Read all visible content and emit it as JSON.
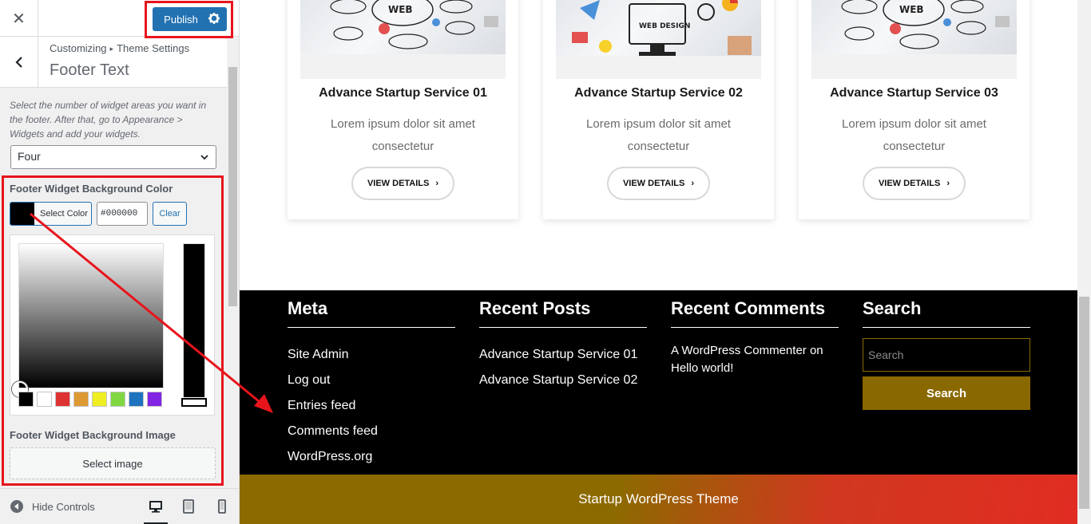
{
  "customizer": {
    "publish_label": "Publish",
    "breadcrumb": {
      "root": "Customizing",
      "parent": "Theme Settings"
    },
    "section_title": "Footer Text",
    "widget_areas": {
      "description": "Select the number of widget areas you want in the footer. After that, go to Appearance > Widgets and add your widgets.",
      "selected": "Four"
    },
    "bg_color": {
      "label": "Footer Widget Background Color",
      "select_label": "Select Color",
      "value": "#000000",
      "clear_label": "Clear",
      "palette": [
        "#000000",
        "#ffffff",
        "#dd3333",
        "#dd9933",
        "#eeee22",
        "#81d742",
        "#1e73be",
        "#8224e3"
      ]
    },
    "bg_image": {
      "label": "Footer Widget Background Image",
      "button_label": "Select image"
    },
    "hide_controls_label": "Hide Controls"
  },
  "preview": {
    "cards": [
      {
        "title": "Advance Startup Service 01",
        "desc": "Lorem ipsum dolor sit amet consectetur",
        "button": "VIEW DETAILS"
      },
      {
        "title": "Advance Startup Service 02",
        "desc": "Lorem ipsum dolor sit amet consectetur",
        "button": "VIEW DETAILS"
      },
      {
        "title": "Advance Startup Service 03",
        "desc": "Lorem ipsum dolor sit amet consectetur",
        "button": "VIEW DETAILS"
      }
    ],
    "footer": {
      "meta": {
        "title": "Meta",
        "links": [
          "Site Admin",
          "Log out",
          "Entries feed",
          "Comments feed",
          "WordPress.org"
        ]
      },
      "recent_posts": {
        "title": "Recent Posts",
        "links": [
          "Advance Startup Service 01",
          "Advance Startup Service 02"
        ]
      },
      "recent_comments": {
        "title": "Recent Comments",
        "text": "A WordPress Commenter on Hello world!"
      },
      "search": {
        "title": "Search",
        "placeholder": "Search",
        "button": "Search"
      }
    },
    "copyright": "Startup WordPress Theme"
  },
  "colors": {
    "accent_blue": "#2271b1",
    "annotation_red": "#e8141c",
    "search_gold": "#8a6800",
    "footer_bg": "#000000"
  }
}
